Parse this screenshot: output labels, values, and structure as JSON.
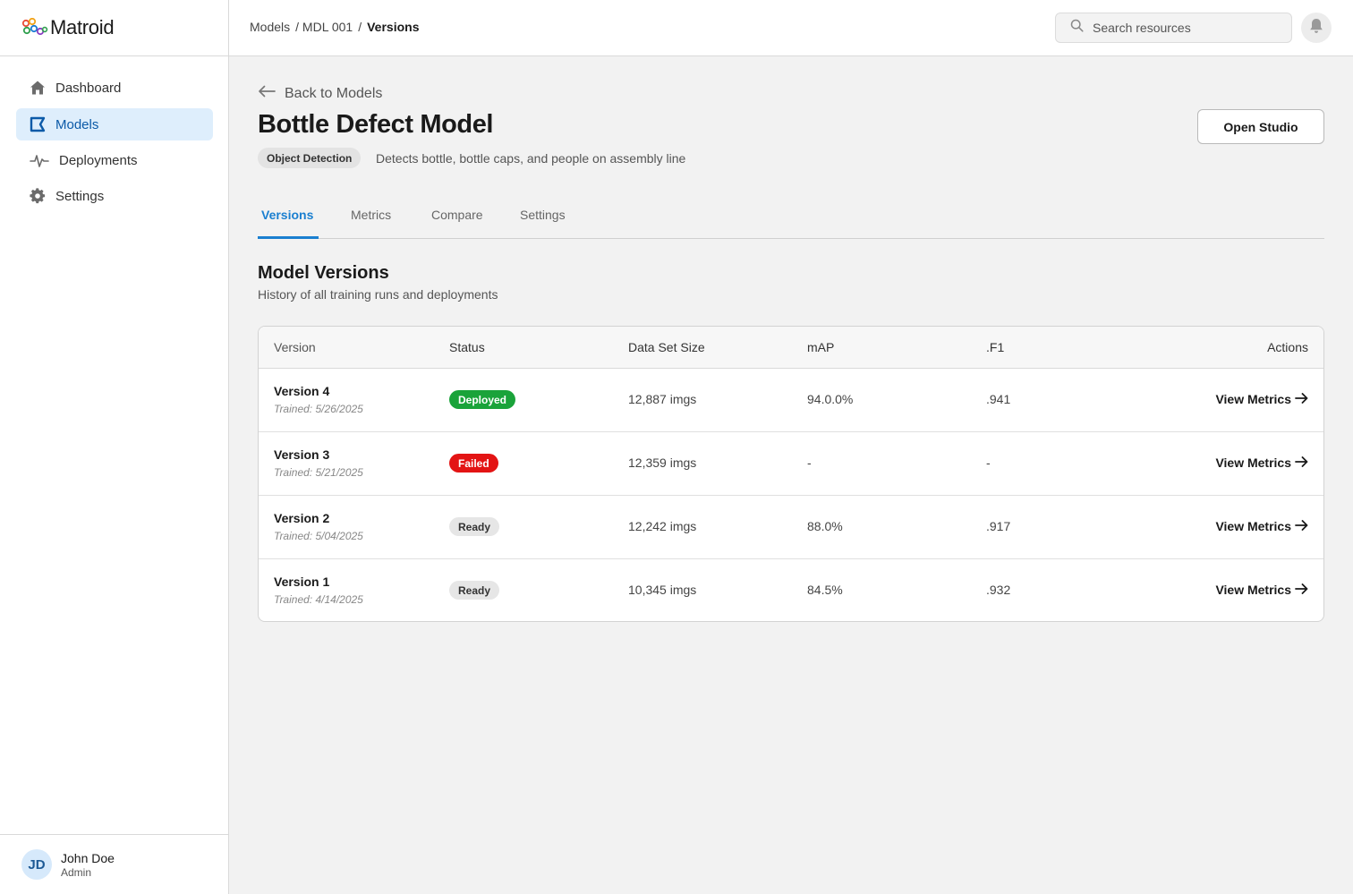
{
  "app": {
    "name": "Matroid"
  },
  "sidebar": {
    "items": [
      {
        "label": "Dashboard",
        "icon": "home-icon",
        "active": false
      },
      {
        "label": "Models",
        "icon": "models-icon",
        "active": true
      },
      {
        "label": "Deployments",
        "icon": "pulse-icon",
        "active": false
      },
      {
        "label": "Settings",
        "icon": "gear-icon",
        "active": false
      }
    ],
    "user": {
      "initials": "JD",
      "name": "John Doe",
      "role": "Admin"
    }
  },
  "header": {
    "breadcrumb": [
      "Models",
      "/ MDL 001",
      "/",
      "Versions"
    ],
    "search_placeholder": "Search resources"
  },
  "model": {
    "back_label": "Back to Models",
    "title": "Bottle Defect Model",
    "type": "Object Detection",
    "description": "Detects bottle, bottle caps, and people on assembly line",
    "open_studio_label": "Open Studio"
  },
  "tabs": [
    {
      "label": "Versions",
      "active": true
    },
    {
      "label": "Metrics",
      "active": false
    },
    {
      "label": "Compare",
      "active": false
    },
    {
      "label": "Settings",
      "active": false
    }
  ],
  "versions_section": {
    "title": "Model Versions",
    "subtitle": "History of all training runs and deployments",
    "columns": [
      "Version",
      "Status",
      "Data Set Size",
      "mAP",
      ".F1",
      "Actions"
    ],
    "rows": [
      {
        "name": "Version 4",
        "trained": "Trained: 5/26/2025",
        "status": "Deployed",
        "status_kind": "deployed",
        "size": "12,887 imgs",
        "map": "94.0.0%",
        "f1": ".941",
        "action": "View Metrics"
      },
      {
        "name": "Version 3",
        "trained": "Trained: 5/21/2025",
        "status": "Failed",
        "status_kind": "failed",
        "size": "12,359 imgs",
        "map": "-",
        "f1": "-",
        "action": "View Metrics"
      },
      {
        "name": "Version 2",
        "trained": "Trained: 5/04/2025",
        "status": "Ready",
        "status_kind": "ready",
        "size": "12,242 imgs",
        "map": "88.0%",
        "f1": ".917",
        "action": "View Metrics"
      },
      {
        "name": "Version 1",
        "trained": "Trained: 4/14/2025",
        "status": "Ready",
        "status_kind": "ready",
        "size": "10,345 imgs",
        "map": "84.5%",
        "f1": ".932",
        "action": "View Metrics"
      }
    ]
  },
  "colors": {
    "accent": "#1a7fd0",
    "active_nav_bg": "#deeefc",
    "deployed": "#1aa33a",
    "failed": "#e31414",
    "ready": "#e6e6e6"
  }
}
